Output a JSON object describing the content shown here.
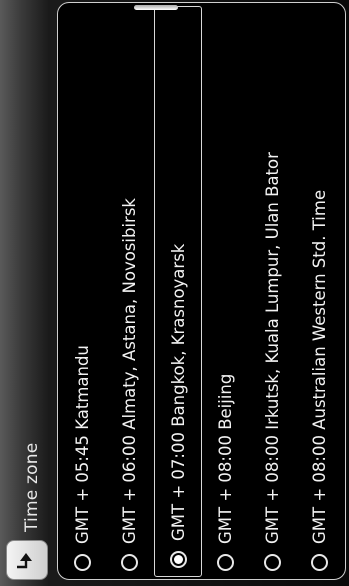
{
  "header": {
    "title": "Time zone",
    "back_icon": "return-arrow-icon"
  },
  "timezones": [
    {
      "label": "GMT + 05:45 Katmandu",
      "selected": false
    },
    {
      "label": "GMT + 06:00 Almaty, Astana, Novosibirsk",
      "selected": false
    },
    {
      "label": "GMT + 07:00 Bangkok, Krasnoyarsk",
      "selected": true
    },
    {
      "label": "GMT + 08:00 Beijing",
      "selected": false
    },
    {
      "label": "GMT + 08:00 Irkutsk, Kuala Lumpur, Ulan Bator",
      "selected": false
    },
    {
      "label": "GMT + 08:00 Australian Western Std. Time",
      "selected": false
    }
  ]
}
